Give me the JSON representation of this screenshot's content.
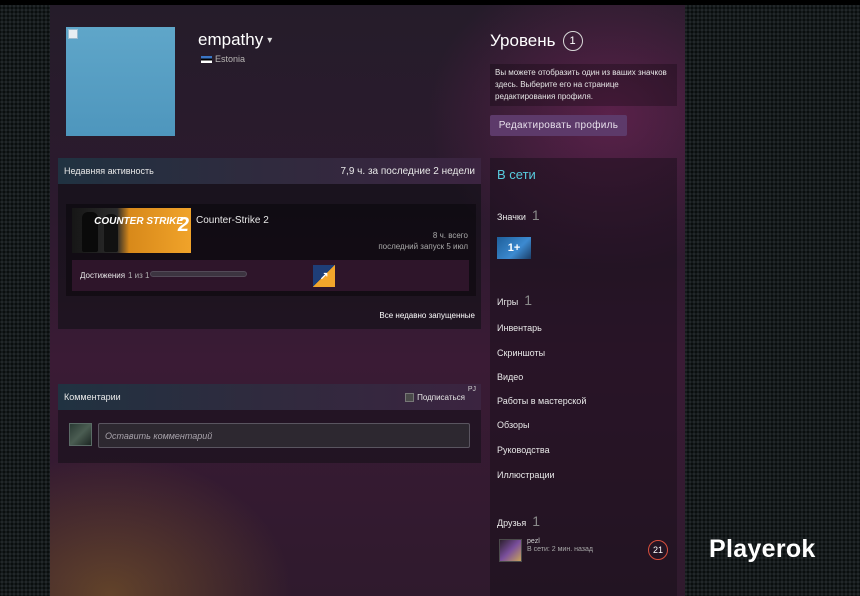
{
  "profile": {
    "name": "empathy",
    "caret": "▾",
    "country": "Estonia"
  },
  "level": {
    "label": "Уровень",
    "value": "1",
    "note": "Вы можете отобразить один из ваших значков здесь. Выберите его на странице редактирования профиля.",
    "edit_button": "Редактировать профиль"
  },
  "activity": {
    "title": "Недавняя активность",
    "hours": "7,9 ч. за последние 2 недели",
    "game": {
      "name": "Counter-Strike 2",
      "capsule_text": "COUNTER STRIKE",
      "capsule_num": "2",
      "total": "8 ч. всего",
      "last_launch": "последний запуск 5 июл",
      "achievements_label": "Достижения",
      "achievements_count": "1 из 1",
      "achievements_progress": 1.0
    },
    "all_recent": "Все недавно запущенные"
  },
  "comments": {
    "title": "Комментарии",
    "subscribe": "Подписаться",
    "corner": "PJ",
    "placeholder": "Оставить комментарий"
  },
  "sidebar": {
    "status": "В сети",
    "badges": {
      "label": "Значки",
      "count": "1",
      "badge_text": "1+"
    },
    "games": {
      "label": "Игры",
      "count": "1"
    },
    "links": [
      "Инвентарь",
      "Скриншоты",
      "Видео",
      "Работы в мастерской",
      "Обзоры",
      "Руководства",
      "Иллюстрации"
    ],
    "friends": {
      "label": "Друзья",
      "count": "1",
      "friend_name": "pezl",
      "friend_status": "В сети: 2 мин. назад",
      "friend_level": "21"
    }
  },
  "watermark": "Playerok",
  "colors": {
    "accent": "#57cbde",
    "button": "#5d3a6a",
    "friend_level_ring": "#d94f3d"
  }
}
